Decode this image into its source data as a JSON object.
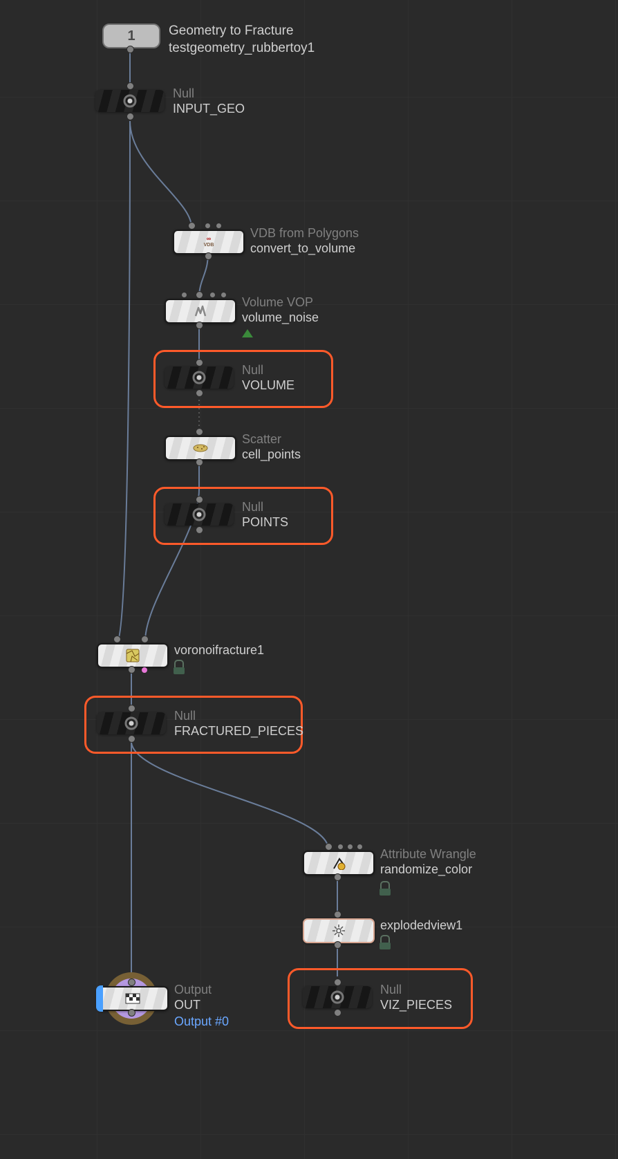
{
  "input": {
    "number": "1",
    "t1": "Geometry to Fracture",
    "t2": "testgeometry_rubbertoy1"
  },
  "n_input_geo": {
    "type": "Null",
    "name": "INPUT_GEO"
  },
  "n_convert": {
    "type": "VDB from Polygons",
    "name": "convert_to_volume"
  },
  "n_volnoise": {
    "type": "Volume VOP",
    "name": "volume_noise"
  },
  "n_volume": {
    "type": "Null",
    "name": "VOLUME"
  },
  "n_scatter": {
    "type": "Scatter",
    "name": "cell_points"
  },
  "n_points": {
    "type": "Null",
    "name": "POINTS"
  },
  "n_voro": {
    "type": "",
    "name": "voronoifracture1"
  },
  "n_frac": {
    "type": "Null",
    "name": "FRACTURED_PIECES"
  },
  "n_wrangle": {
    "type": "Attribute Wrangle",
    "name": "randomize_color"
  },
  "n_explode": {
    "type": "",
    "name": "explodedview1"
  },
  "n_viz": {
    "type": "Null",
    "name": "VIZ_PIECES"
  },
  "n_out": {
    "type": "Output",
    "name": "OUT",
    "sub": "Output #0"
  },
  "colors": {
    "highlight": "#ff5a2a"
  }
}
